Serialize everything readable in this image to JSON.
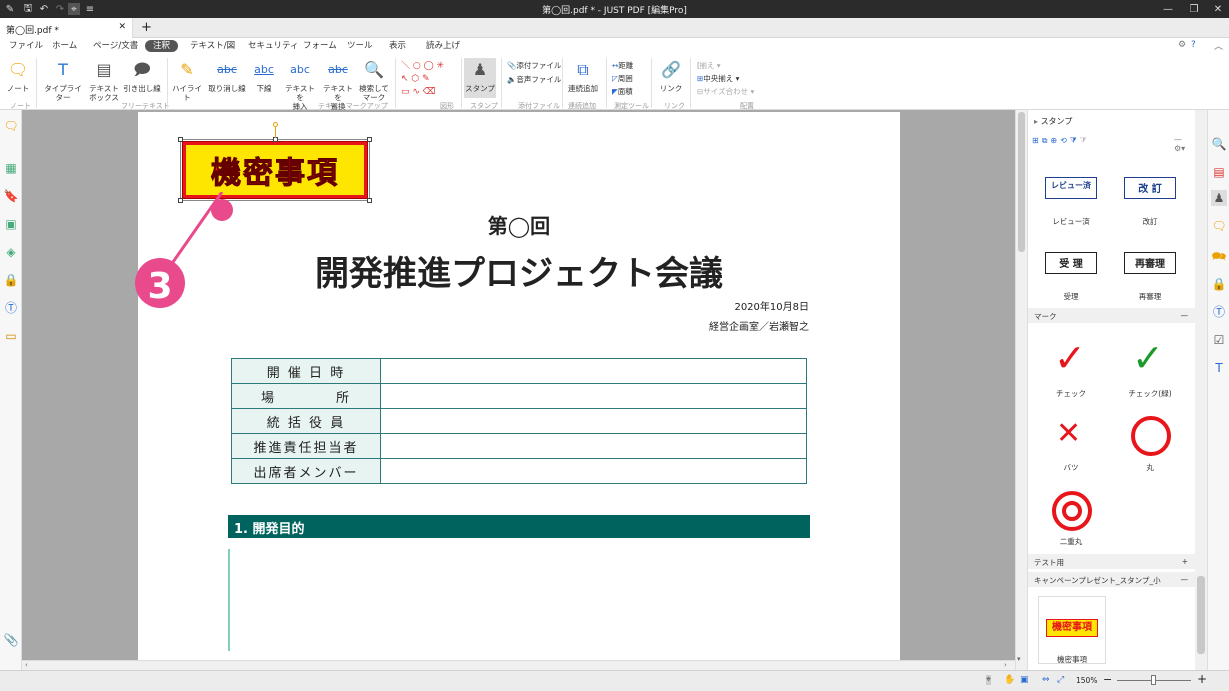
{
  "window": {
    "title": "第◯回.pdf * - JUST PDF [編集Pro]"
  },
  "tabs": [
    {
      "label": "第◯回.pdf *"
    }
  ],
  "menu": [
    "ファイル",
    "ホーム",
    "ページ/文書",
    "注釈",
    "テキスト/図",
    "セキュリティ",
    "フォーム",
    "ツール",
    "表示",
    "読み上げ"
  ],
  "ribbon": {
    "note": "ノート",
    "typewriter": "タイプライター",
    "textbox": "テキスト\nボックス",
    "callout": "引き出し線",
    "highlight": "ハイライト",
    "strike": "取り消し線",
    "underline": "下線",
    "insert_text": "テキストを\n挿入",
    "replace_text": "テキストを\n置換",
    "search_mark": "検索して\nマーク",
    "stamp": "スタンプ",
    "attach_file": "添付ファイル",
    "voice_file": "音声ファイル",
    "continuous_add": "連続追加",
    "distance": "距離",
    "perimeter": "周囲",
    "area": "面積",
    "link": "リンク",
    "align": "揃え",
    "center_align": "中央揃え",
    "size_align": "サイズ合わせ",
    "groups": {
      "note": "ノート",
      "freetext": "フリーテキスト",
      "markup": "テキストマークアップ",
      "shape": "図形",
      "stamp": "スタンプ",
      "attach": "添付ファイル",
      "continuous": "連続追加",
      "measure": "測定ツール",
      "link": "リンク",
      "arrange": "配置"
    }
  },
  "document": {
    "stamp_text": "機密事項",
    "callout_number": "3",
    "heading_small": "第◯回",
    "heading_large": "開発推進プロジェクト会議",
    "date": "2020年10月8日",
    "author": "経営企画室／岩瀬智之",
    "table_rows": [
      "開 催 日 時",
      "場　　　　所",
      "統 括 役 員",
      "推進責任担当者",
      "出席者メンバー"
    ],
    "section1": "1. 開発目的"
  },
  "panel": {
    "title": "スタンプ",
    "stamps": [
      {
        "text": "レビュー済",
        "caption": "レビュー済"
      },
      {
        "text": "改 訂",
        "caption": "改訂"
      },
      {
        "text": "受 理",
        "caption": "受理"
      },
      {
        "text": "再審理",
        "caption": "再審理"
      }
    ],
    "mark_section": "マーク",
    "marks": [
      {
        "caption": "チェック"
      },
      {
        "caption": "チェック(緑)"
      },
      {
        "caption": "バツ"
      },
      {
        "caption": "丸"
      },
      {
        "caption": "二重丸"
      }
    ],
    "test_section": "テスト用",
    "campaign_section": "キャンペーンプレゼント_スタンプ_小",
    "campaign_caption": "機密事項",
    "stamp_text": "機密事項"
  },
  "status": {
    "zoom": "150%"
  },
  "colors": {
    "teal": "#00635e",
    "pink": "#e84a8c",
    "stamp_red": "#e8151b",
    "stamp_yellow": "#ffe600"
  }
}
